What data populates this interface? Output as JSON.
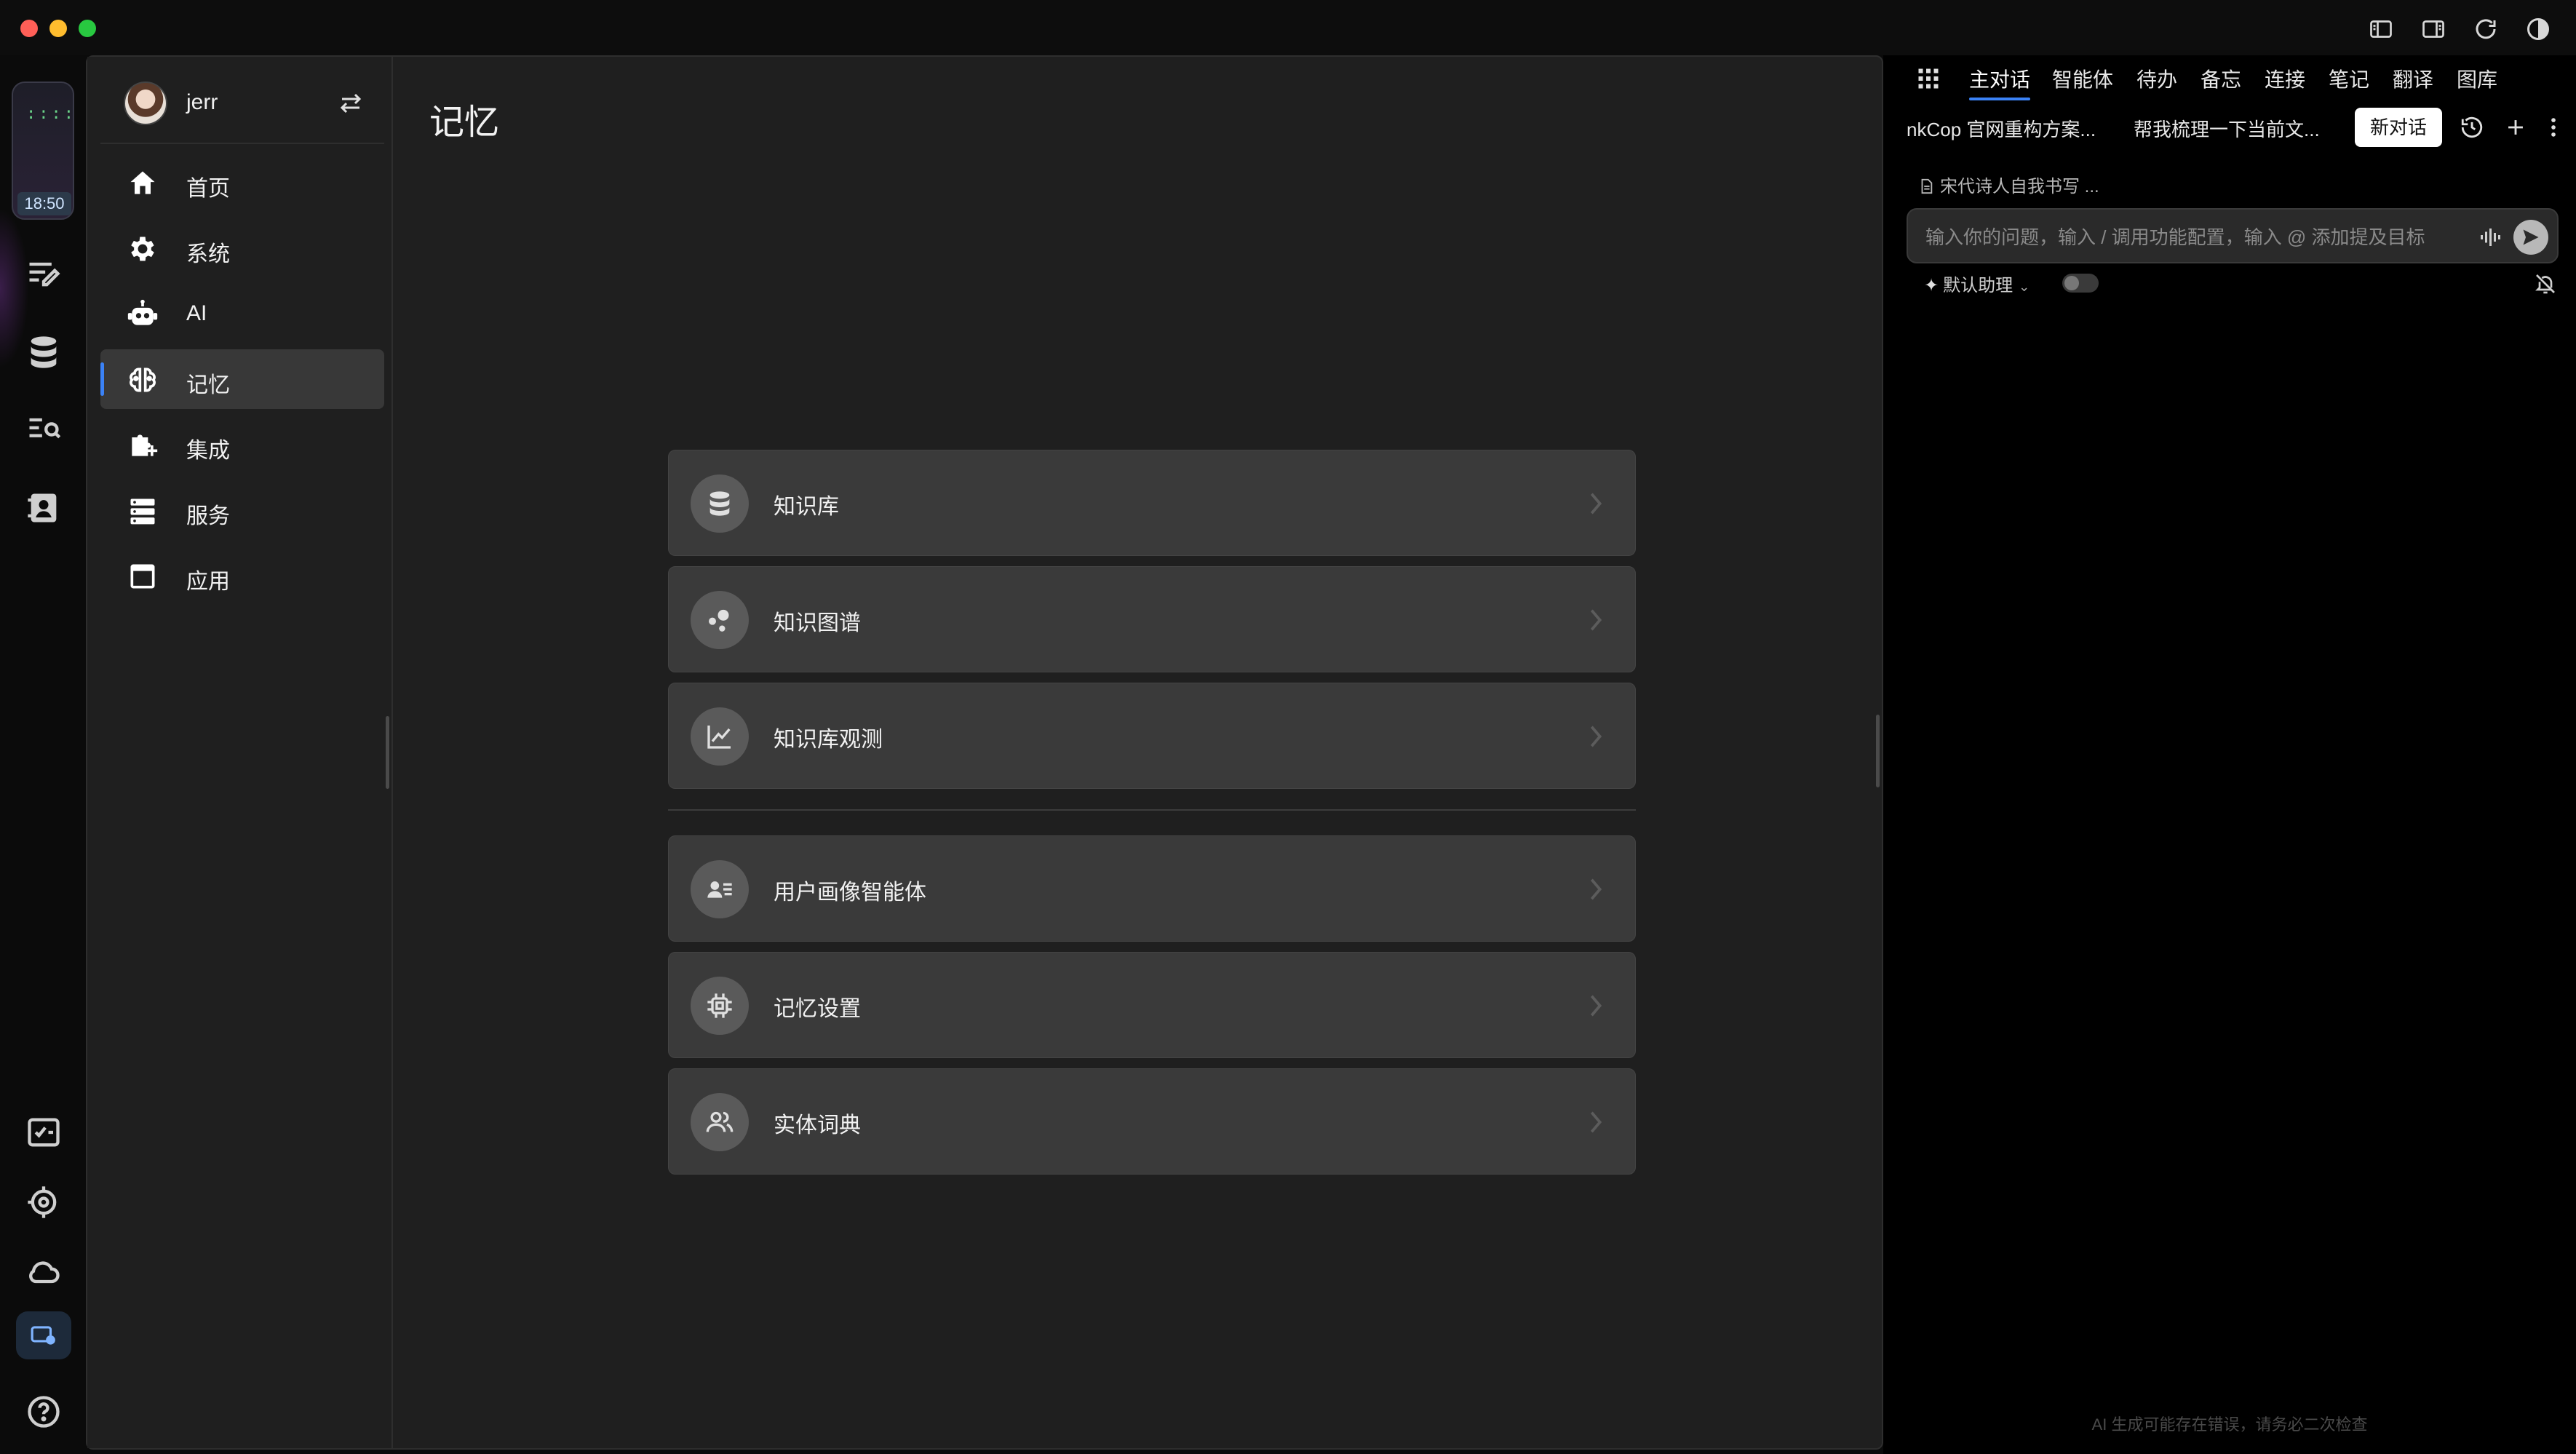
{
  "window": {
    "clock_time": "18:50"
  },
  "user": {
    "name": "jerr"
  },
  "sidebar": {
    "items": [
      {
        "label": "首页",
        "icon": "home-icon"
      },
      {
        "label": "系统",
        "icon": "gear-icon"
      },
      {
        "label": "AI",
        "icon": "robot-icon"
      },
      {
        "label": "记忆",
        "icon": "brain-icon",
        "active": true
      },
      {
        "label": "集成",
        "icon": "puzzle-icon"
      },
      {
        "label": "服务",
        "icon": "server-icon"
      },
      {
        "label": "应用",
        "icon": "app-window-icon"
      }
    ]
  },
  "main": {
    "title": "记忆",
    "cards": [
      {
        "label": "知识库",
        "icon": "database-icon"
      },
      {
        "label": "知识图谱",
        "icon": "graph-icon"
      },
      {
        "label": "知识库观测",
        "icon": "line-chart-icon"
      },
      {
        "label": "用户画像智能体",
        "icon": "profile-icon"
      },
      {
        "label": "记忆设置",
        "icon": "chip-icon"
      },
      {
        "label": "实体词典",
        "icon": "people-icon"
      }
    ]
  },
  "chat": {
    "tabs": [
      "主对话",
      "智能体",
      "待办",
      "备忘",
      "连接",
      "笔记",
      "翻译",
      "图库"
    ],
    "active_tab": "主对话",
    "conversations": [
      "nkCop 官网重构方案...",
      "帮我梳理一下当前文..."
    ],
    "new_conversation_label": "新对话",
    "file_reference": "宋代诗人自我书写 ...",
    "input_placeholder": "输入你的问题，输入 / 调用功能配置，输入 @ 添加提及目标",
    "assistant_label": "默认助理",
    "disclaimer": "AI 生成可能存在错误，请务必二次检查"
  },
  "colors": {
    "accent": "#3b82f6",
    "background": "#1f1f1f",
    "card": "#3a3a3a"
  }
}
